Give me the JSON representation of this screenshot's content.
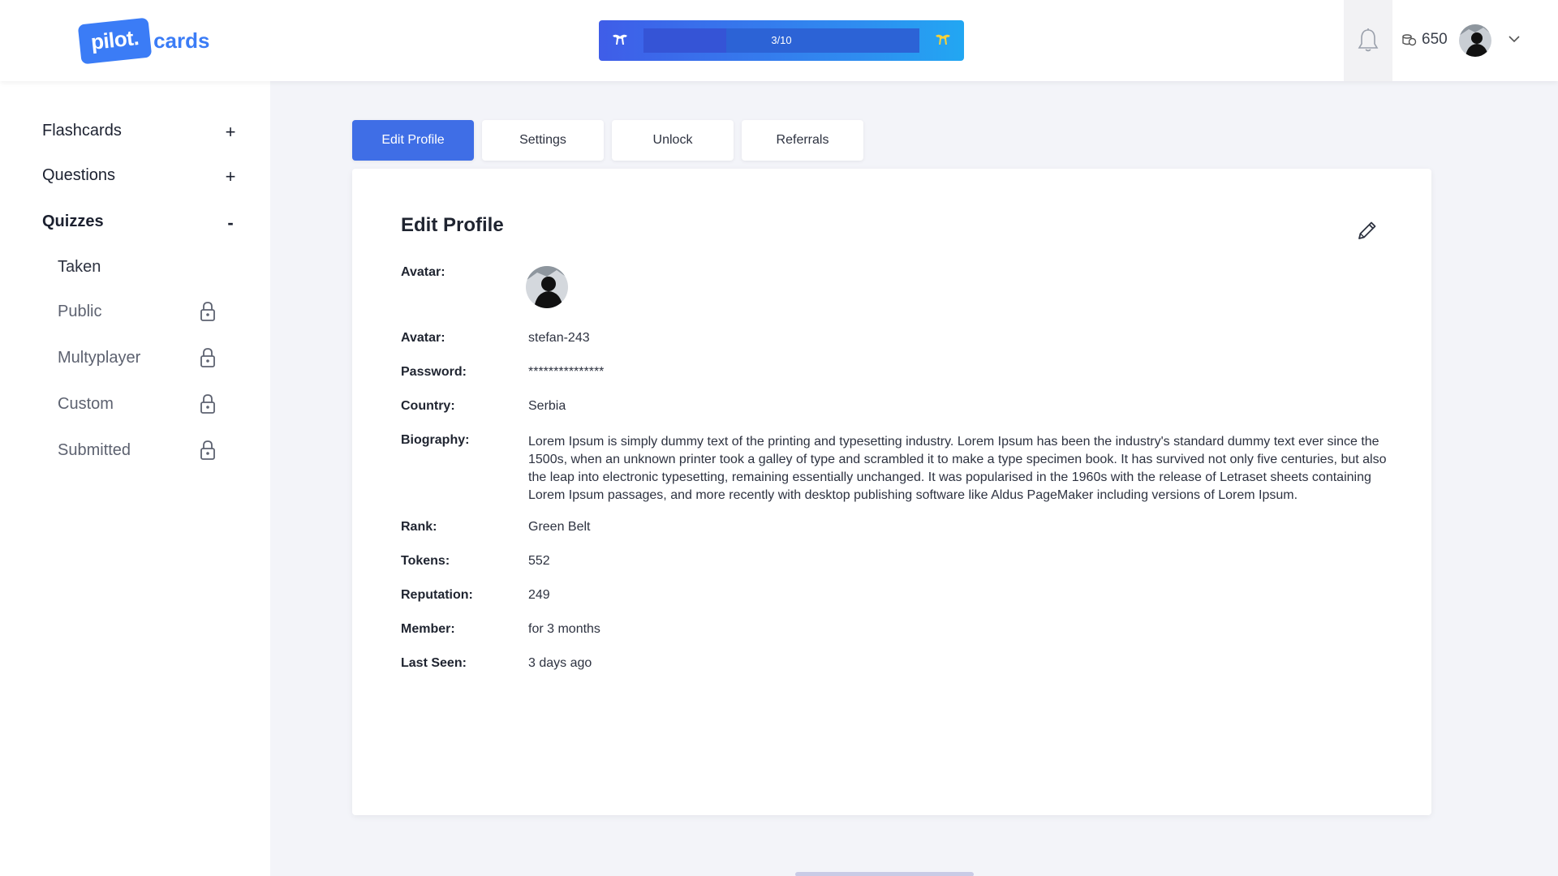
{
  "header": {
    "logo_badge": "pilot.",
    "logo_text": "cards",
    "progress_label": "3/10",
    "progress_fraction": 0.3,
    "coins": "650",
    "colors": {
      "brand": "#3b7cf6",
      "progress_start": "#3f5de8",
      "progress_end": "#22a7f2",
      "accent_yellow": "#f5d13a"
    }
  },
  "sidebar": {
    "top_items": [
      {
        "label": "Flashcards",
        "sign": "+"
      },
      {
        "label": "Questions",
        "sign": "+"
      },
      {
        "label": "Quizzes",
        "sign": "-"
      }
    ],
    "sub_items": [
      {
        "label": "Taken",
        "locked": false
      },
      {
        "label": "Public",
        "locked": true
      },
      {
        "label": "Multyplayer",
        "locked": true
      },
      {
        "label": "Custom",
        "locked": true
      },
      {
        "label": "Submitted",
        "locked": true
      }
    ]
  },
  "tabs": [
    {
      "label": "Edit Profile",
      "active": true
    },
    {
      "label": "Settings",
      "active": false
    },
    {
      "label": "Unlock",
      "active": false
    },
    {
      "label": "Referrals",
      "active": false
    }
  ],
  "profile": {
    "title": "Edit Profile",
    "avatar_label": "Avatar:",
    "fields": [
      {
        "label": "Avatar:",
        "value": "stefan-243"
      },
      {
        "label": "Password:",
        "value": "***************"
      },
      {
        "label": "Country:",
        "value": "Serbia"
      },
      {
        "label": "Biography:",
        "value": "Lorem Ipsum is simply dummy text of the printing and typesetting industry. Lorem Ipsum has been the industry's standard dummy text ever since the 1500s, when an unknown printer took a galley of type and scrambled it to make a type specimen book. It has survived not only five centuries, but also the leap into electronic typesetting, remaining essentially unchanged. It was popularised in the 1960s with the release of Letraset sheets containing Lorem Ipsum passages, and more recently with desktop publishing software like Aldus PageMaker including versions of Lorem Ipsum."
      },
      {
        "label": "Rank:",
        "value": "Green Belt"
      },
      {
        "label": "Tokens:",
        "value": "552"
      },
      {
        "label": "Reputation:",
        "value": "249"
      },
      {
        "label": "Member:",
        "value": "for 3 months"
      },
      {
        "label": "Last Seen:",
        "value": "3 days ago"
      }
    ]
  },
  "icons": {
    "progress_left": "ram-horns-icon",
    "progress_right": "ram-horns-icon",
    "notifications": "bell-icon",
    "coins": "coin-stack-icon",
    "dropdown": "chevron-down-icon",
    "edit": "pencil-icon",
    "lock": "lock-icon"
  }
}
